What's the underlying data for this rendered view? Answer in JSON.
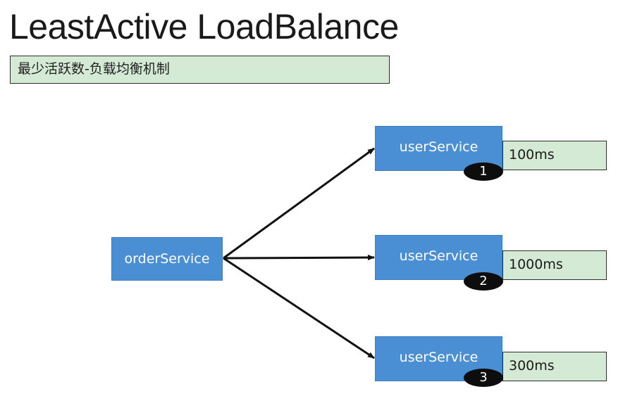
{
  "title": "LeastActive LoadBalance",
  "subtitle": "最少活跃数-负载均衡机制",
  "source_node": {
    "label": "orderService"
  },
  "target_nodes": [
    {
      "label": "userService",
      "badge": "1",
      "latency": "100ms"
    },
    {
      "label": "userService",
      "badge": "2",
      "latency": "1000ms"
    },
    {
      "label": "userService",
      "badge": "3",
      "latency": "300ms"
    }
  ],
  "colors": {
    "node_fill": "#4a8fd4",
    "label_fill": "#d4ead4",
    "badge_fill": "#0d0d0d",
    "arrow": "#111111"
  }
}
